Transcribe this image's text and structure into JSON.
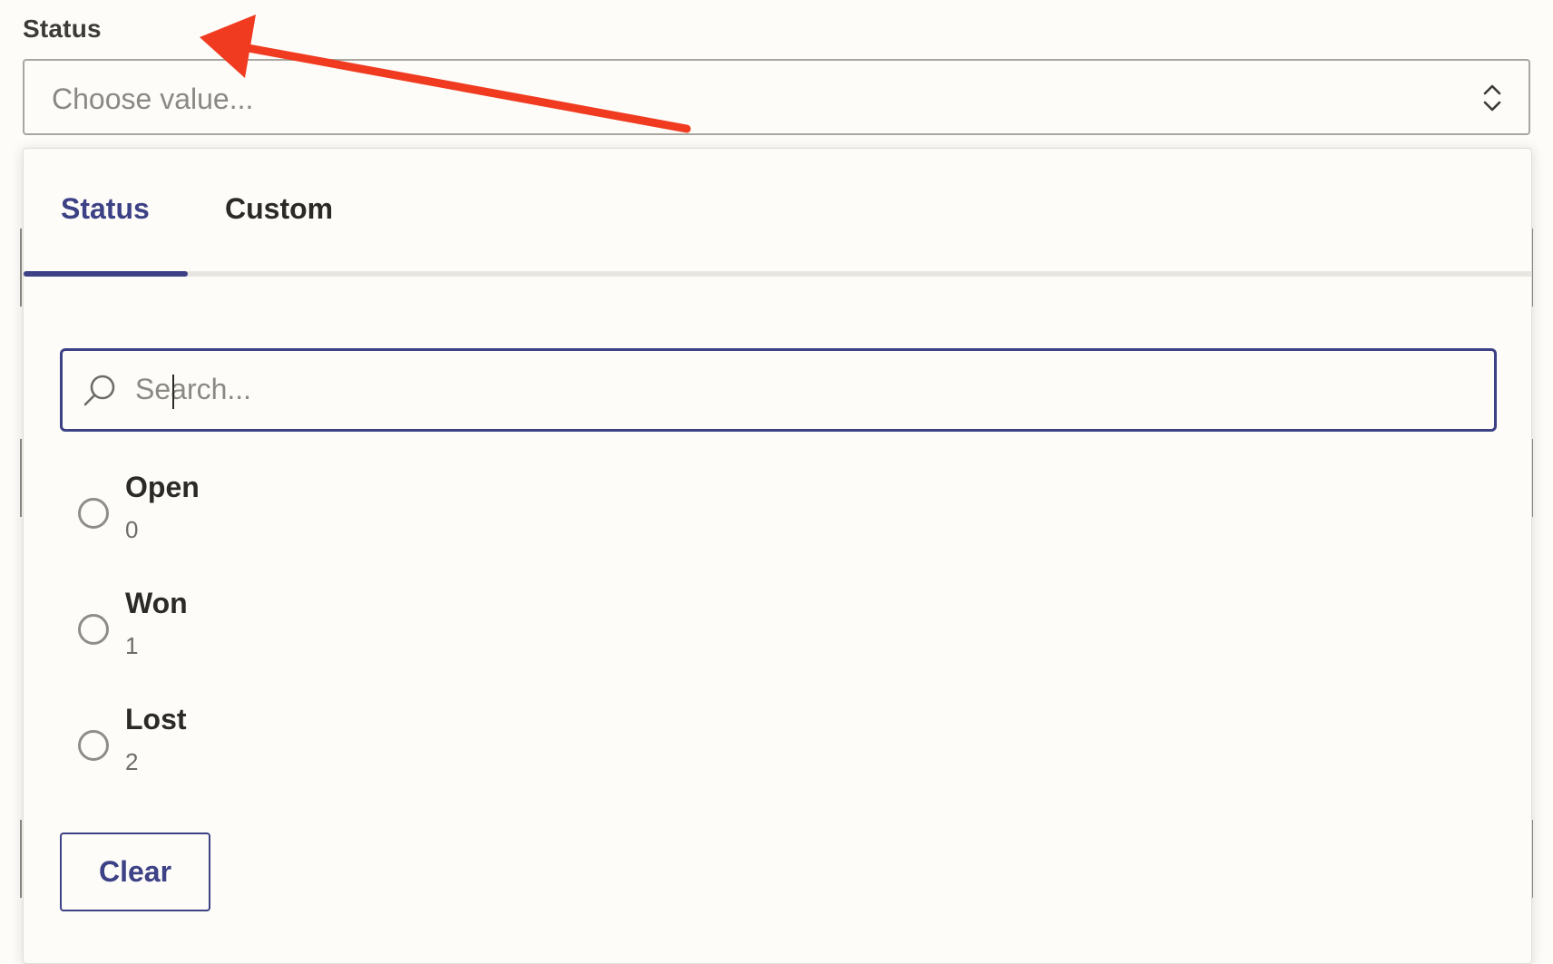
{
  "field": {
    "label": "Status",
    "placeholder": "Choose value..."
  },
  "dropdown": {
    "tabs": [
      {
        "label": "Status",
        "active": true
      },
      {
        "label": "Custom",
        "active": false
      }
    ],
    "search": {
      "placeholder": "Search...",
      "value": ""
    },
    "options": [
      {
        "label": "Open",
        "value": "0"
      },
      {
        "label": "Won",
        "value": "1"
      },
      {
        "label": "Lost",
        "value": "2"
      }
    ],
    "clear_label": "Clear"
  },
  "annotation": {
    "arrow_color": "#f03b20"
  },
  "colors": {
    "accent": "#3d4185",
    "background": "#fdfcf9"
  },
  "icons": {
    "search": "search-icon",
    "caret": "chevron-up-down-icon",
    "radio": "radio-unchecked-icon"
  }
}
